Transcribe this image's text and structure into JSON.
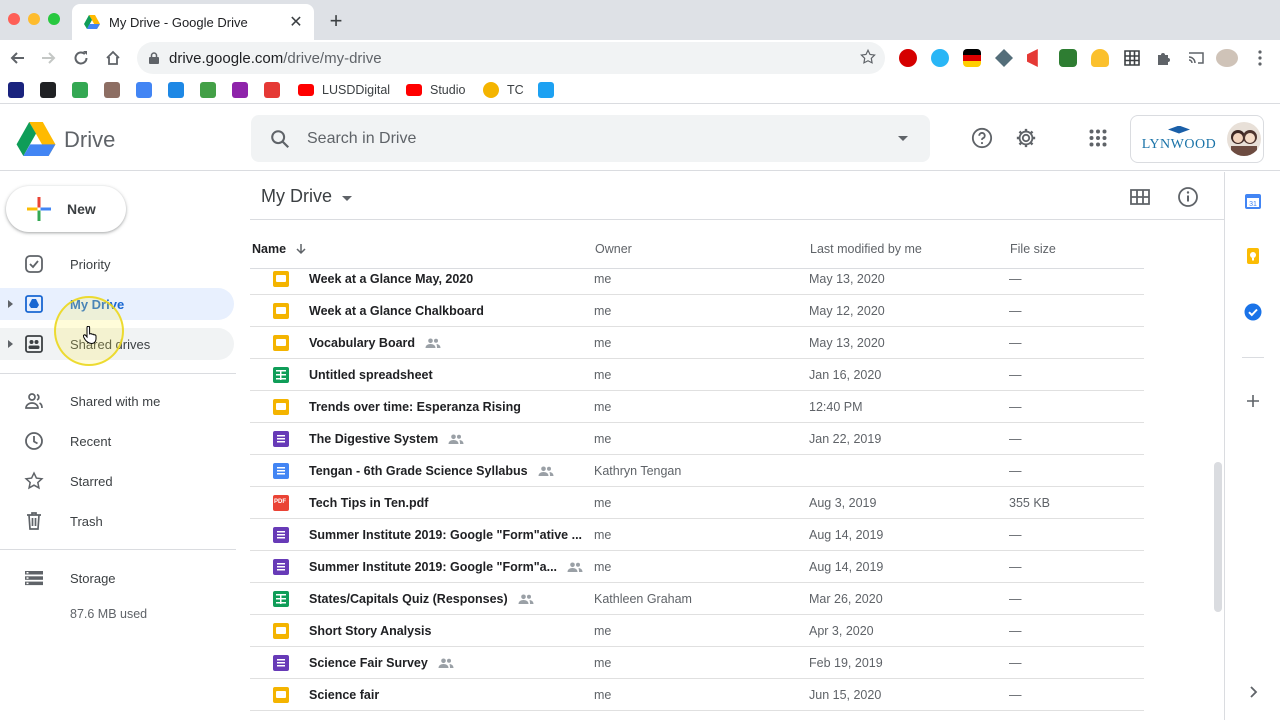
{
  "browser": {
    "tab_title": "My Drive - Google Drive",
    "close_glyph": "✕",
    "new_tab_glyph": "+",
    "url_host": "drive.google.com",
    "url_path": "/drive/my-drive",
    "bookmarks": [
      {
        "label": "",
        "icon": "adobe-icon",
        "color": "#1a237e"
      },
      {
        "label": "",
        "icon": "apps-grid-icon",
        "color": "#202124"
      },
      {
        "label": "",
        "icon": "plus-circle-icon",
        "color": "#34a853"
      },
      {
        "label": "",
        "icon": "acorn-icon",
        "color": "#8d6e63"
      },
      {
        "label": "",
        "icon": "c-icon",
        "color": "#4285f4"
      },
      {
        "label": "",
        "icon": "book-icon",
        "color": "#1e88e5"
      },
      {
        "label": "",
        "icon": "image-icon",
        "color": "#43a047"
      },
      {
        "label": "",
        "icon": "mascot-icon",
        "color": "#8e24aa"
      },
      {
        "label": "",
        "icon": "kite-icon",
        "color": "#e53935"
      },
      {
        "label": "LUSDDigital",
        "icon": "youtube-icon",
        "color": "#ff0000"
      },
      {
        "label": "Studio",
        "icon": "youtube-icon",
        "color": "#ff0000"
      },
      {
        "label": "TC",
        "icon": "circle-icon",
        "color": "#f4b400"
      },
      {
        "label": "",
        "icon": "twitter-icon",
        "color": "#1da1f2"
      }
    ]
  },
  "header": {
    "app_name": "Drive",
    "search_placeholder": "Search in Drive",
    "org_name": "LYNWOOD"
  },
  "sidebar": {
    "new_label": "New",
    "items": [
      {
        "label": "Priority",
        "icon": "priority-check-icon"
      },
      {
        "label": "My Drive",
        "icon": "my-drive-icon",
        "active": true
      },
      {
        "label": "Shared drives",
        "icon": "shared-drives-icon"
      },
      {
        "label": "Shared with me",
        "icon": "people-icon"
      },
      {
        "label": "Recent",
        "icon": "clock-icon"
      },
      {
        "label": "Starred",
        "icon": "star-icon"
      },
      {
        "label": "Trash",
        "icon": "trash-icon"
      },
      {
        "label": "Storage",
        "icon": "storage-icon"
      }
    ],
    "storage_used": "87.6 MB used"
  },
  "main": {
    "title": "My Drive",
    "columns": {
      "name": "Name",
      "owner": "Owner",
      "modified": "Last modified by me",
      "size": "File size"
    },
    "files": [
      {
        "name": "Week at a Glance May, 2020",
        "type": "slides",
        "shared": false,
        "owner": "me",
        "modified": "May 13, 2020",
        "size": "—"
      },
      {
        "name": "Week at a Glance Chalkboard",
        "type": "slides",
        "shared": false,
        "owner": "me",
        "modified": "May 12, 2020",
        "size": "—"
      },
      {
        "name": "Vocabulary Board",
        "type": "slides",
        "shared": true,
        "owner": "me",
        "modified": "May 13, 2020",
        "size": "—"
      },
      {
        "name": "Untitled spreadsheet",
        "type": "sheets",
        "shared": false,
        "owner": "me",
        "modified": "Jan 16, 2020",
        "size": "—"
      },
      {
        "name": "Trends over time: Esperanza Rising",
        "type": "slides",
        "shared": false,
        "owner": "me",
        "modified": "12:40 PM",
        "size": "—"
      },
      {
        "name": "The Digestive System",
        "type": "forms",
        "shared": true,
        "owner": "me",
        "modified": "Jan 22, 2019",
        "size": "—"
      },
      {
        "name": "Tengan - 6th Grade Science Syllabus",
        "type": "docs",
        "shared": true,
        "owner": "Kathryn Tengan",
        "modified": "",
        "size": "—"
      },
      {
        "name": "Tech Tips in Ten.pdf",
        "type": "pdf",
        "shared": false,
        "owner": "me",
        "modified": "Aug 3, 2019",
        "size": "355 KB"
      },
      {
        "name": "Summer Institute 2019: Google \"Form\"ative ...",
        "type": "forms",
        "shared": false,
        "owner": "me",
        "modified": "Aug 14, 2019",
        "size": "—"
      },
      {
        "name": "Summer Institute 2019: Google \"Form\"a...",
        "type": "forms",
        "shared": true,
        "owner": "me",
        "modified": "Aug 14, 2019",
        "size": "—"
      },
      {
        "name": "States/Capitals Quiz (Responses)",
        "type": "sheets",
        "shared": true,
        "owner": "Kathleen Graham",
        "modified": "Mar 26, 2020",
        "size": "—"
      },
      {
        "name": "Short Story Analysis",
        "type": "slides",
        "shared": false,
        "owner": "me",
        "modified": "Apr 3, 2020",
        "size": "—"
      },
      {
        "name": "Science Fair Survey",
        "type": "forms",
        "shared": true,
        "owner": "me",
        "modified": "Feb 19, 2019",
        "size": "—"
      },
      {
        "name": "Science fair",
        "type": "slides",
        "shared": false,
        "owner": "me",
        "modified": "Jun 15, 2020",
        "size": "—"
      }
    ]
  },
  "colors": {
    "slides": "#f4b400",
    "sheets": "#0f9d58",
    "forms": "#673ab7",
    "docs": "#4285f4",
    "pdf": "#ea4335",
    "accent": "#1967d2",
    "active_bg": "#e8f0fe"
  },
  "side_panel": {
    "calendar_date": "31",
    "apps": [
      "calendar-icon",
      "keep-icon",
      "tasks-icon",
      "add-addon-icon",
      "expand-panel-icon"
    ]
  }
}
